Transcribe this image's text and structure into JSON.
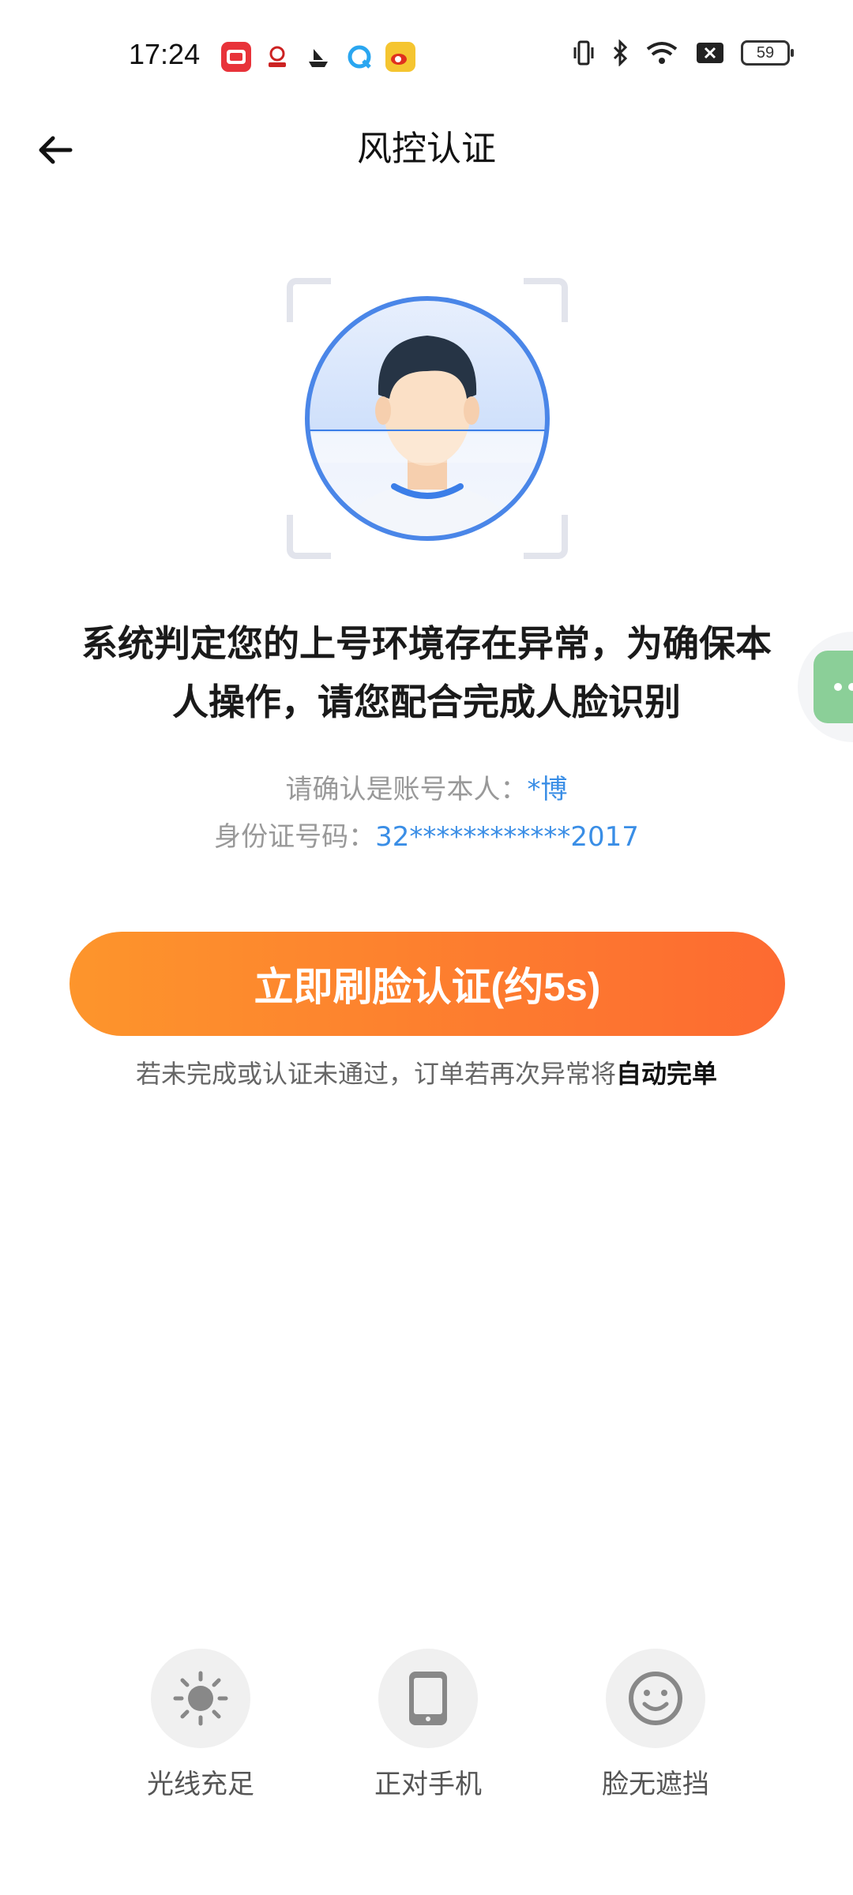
{
  "status_bar": {
    "time": "17:24",
    "battery": "59",
    "notification_icons": [
      "app-icon-red",
      "app-icon-game",
      "app-icon-ship",
      "app-icon-browser",
      "app-icon-weibo"
    ],
    "system_icons": [
      "vibrate-icon",
      "bluetooth-icon",
      "wifi-icon",
      "sim-blocked-icon",
      "battery-icon"
    ]
  },
  "nav": {
    "title": "风控认证",
    "back_icon": "arrow-left-icon"
  },
  "face": {
    "icon": "face-scan-icon",
    "accent_color": "#4a86e8"
  },
  "headline": {
    "line1": "系统判定您的上号环境存在异常，为确保本",
    "line2": "人操作，请您配合完成人脸识别"
  },
  "info": {
    "account_label": "请确认是账号本人：",
    "account_value": "*博",
    "id_label": "身份证号码：",
    "id_value": "32************2017"
  },
  "action": {
    "button_label": "立即刷脸认证(约5s)",
    "gradient_start": "#fd952c",
    "gradient_end": "#fd6a31"
  },
  "notice": {
    "text": "若未完成或认证未通过，订单若再次异常将",
    "strong": "自动完单"
  },
  "tips": [
    {
      "icon": "sun-icon",
      "label": "光线充足"
    },
    {
      "icon": "phone-icon",
      "label": "正对手机"
    },
    {
      "icon": "smile-face-icon",
      "label": "脸无遮挡"
    }
  ]
}
